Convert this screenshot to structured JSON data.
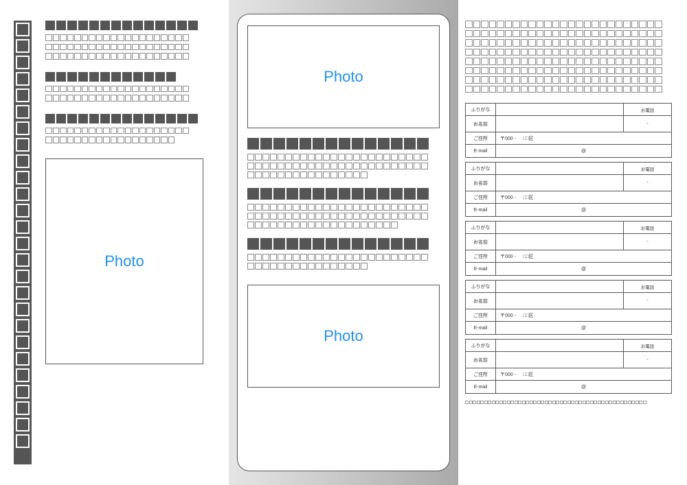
{
  "left": {
    "strip_boxes": 26,
    "sections": [
      {
        "heading_boxes": 14,
        "body_lines_boxes": [
          20,
          20,
          20
        ]
      },
      {
        "heading_boxes": 12,
        "body_lines_boxes": [
          20,
          20
        ]
      },
      {
        "heading_boxes": 14,
        "body_lines_boxes": [
          20,
          18
        ]
      }
    ],
    "photo_label": "Photo"
  },
  "middle": {
    "photo_top_label": "Photo",
    "sections": [
      {
        "heading_boxes": 14,
        "body_lines_boxes": [
          24,
          24,
          16
        ]
      },
      {
        "heading_boxes": 14,
        "body_lines_boxes": [
          24,
          24,
          20
        ]
      },
      {
        "heading_boxes": 14,
        "body_lines_boxes": [
          24,
          16
        ]
      }
    ],
    "photo_bottom_label": "Photo"
  },
  "right": {
    "top_lines_boxes": [
      25,
      25,
      25,
      25,
      25,
      25,
      25,
      25
    ],
    "contact": {
      "labels": {
        "furigana": "ふりがな",
        "name": "お名前",
        "tel": "お電話",
        "tel_dash": "-",
        "address": "ご住所",
        "postal": "〒000 -",
        "ward": "□□区",
        "email": "E-mail",
        "at": "@"
      },
      "blocks": 5
    },
    "footer_boxes": 48
  }
}
